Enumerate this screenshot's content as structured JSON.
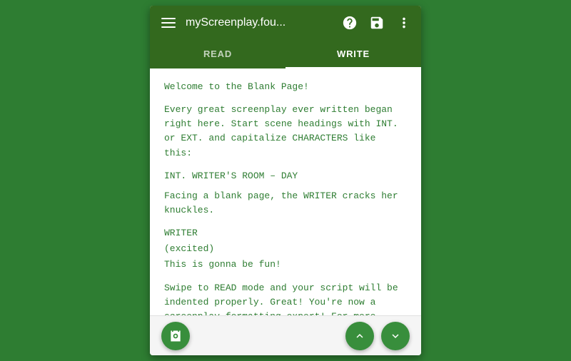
{
  "topbar": {
    "title": "myScreenplay.fou...",
    "menu_label": "menu",
    "help_label": "?",
    "save_label": "save",
    "more_label": "more"
  },
  "tabs": [
    {
      "id": "read",
      "label": "READ",
      "active": false
    },
    {
      "id": "write",
      "label": "WRITE",
      "active": true
    }
  ],
  "content": {
    "para1": "Welcome to the Blank Page!",
    "para2": "Every great screenplay ever written began right here. Start scene headings with INT. or EXT. and capitalize CHARACTERS like this:",
    "scene_heading": "INT. WRITER'S ROOM – DAY",
    "action": "Facing a blank page, the WRITER cracks her knuckles.",
    "character": "WRITER",
    "parenthetical": "(excited)",
    "dialogue": "This is gonna be fun!",
    "para_end": "Swipe to READ mode and your script will be indented properly. Great! You're now a screenplay-formatting expert! For more writing tips, check the side drawer."
  },
  "bottom": {
    "camera_label": "camera",
    "up_label": "▲",
    "down_label": "▼"
  }
}
